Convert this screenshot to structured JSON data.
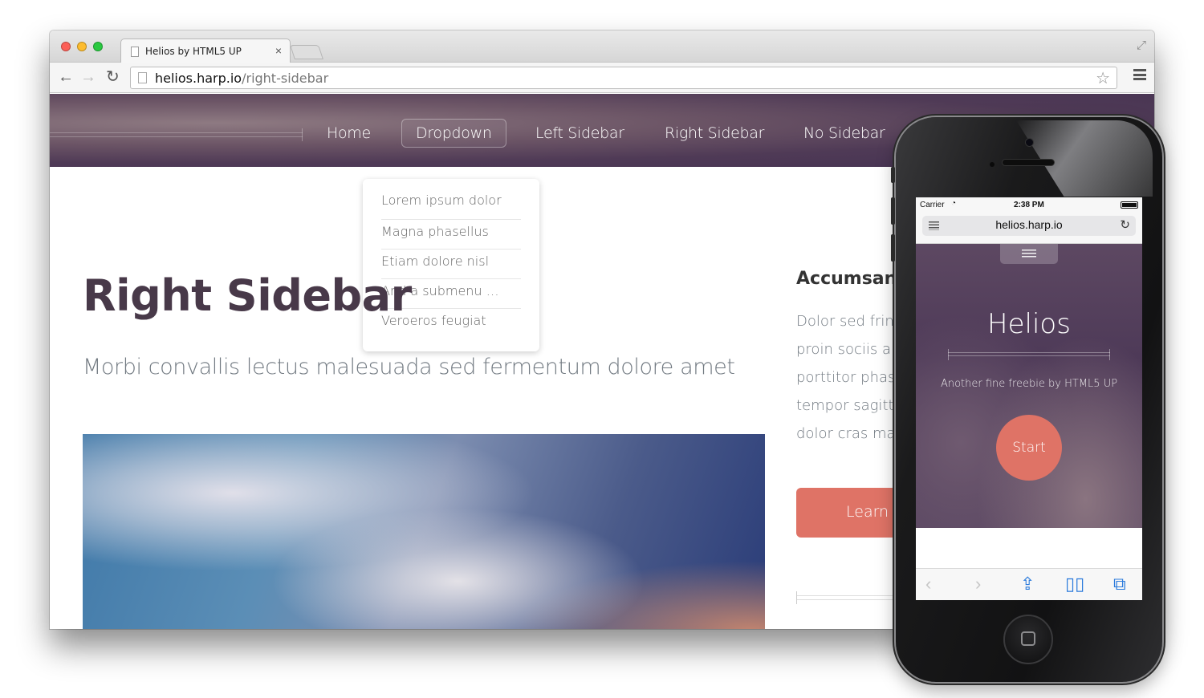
{
  "browser": {
    "tab_title": "Helios by HTML5 UP",
    "tab_close": "×",
    "url_host": "helios.harp.io",
    "url_path": "/right-sidebar"
  },
  "site": {
    "nav": [
      "Home",
      "Dropdown",
      "Left Sidebar",
      "Right Sidebar",
      "No Sidebar"
    ],
    "active_nav": "Dropdown",
    "dropdown_items": [
      "Lorem ipsum dolor",
      "Magna phasellus",
      "Etiam dolore nisl",
      "And a submenu …",
      "Veroeros feugiat"
    ],
    "title": "Right Sidebar",
    "subtitle": "Morbi convallis lectus malesuada sed fermentum dolore amet",
    "sidebar": {
      "heading": "Accumsan s",
      "lines": [
        "Dolor sed fring",
        "proin  sociis  a",
        "porttitor    phas",
        "tempor sagittis",
        "dolor cras mag"
      ],
      "button": "Learn M"
    }
  },
  "phone": {
    "carrier": "Carrier",
    "time": "2:38 PM",
    "url": "helios.harp.io",
    "title": "Helios",
    "tagline": "Another fine freebie by HTML5 UP",
    "start": "Start"
  },
  "colors": {
    "header_purple": "#4f3a56",
    "accent_coral": "#df7366",
    "title_text": "#483949",
    "body_text": "#717981",
    "ios_blue": "#2b7bdc"
  }
}
